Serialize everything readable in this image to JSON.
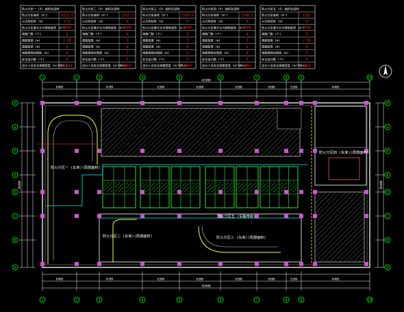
{
  "title_blocks": [
    {
      "rows": [
        {
          "label": "防火分区一 (4) 面积及说明",
          "value": ""
        },
        {
          "label": "防火分区面积 (m²)",
          "value": "2253.8"
        },
        {
          "label": "火灾危险性 (m)",
          "value": "3.6"
        },
        {
          "label": "防火分区最大允许建筑面积 (m²)",
          "value": "4000"
        },
        {
          "label": "疏散门数 (个)",
          "value": "4"
        },
        {
          "label": "疏散宽度 (m)",
          "value": "1.88"
        },
        {
          "label": "疏散距离 (m)",
          "value": "5"
        },
        {
          "label": "疏散楼梯间宽度 (m)",
          "value": "8"
        },
        {
          "label": "安全出口数 (个)",
          "value": "6"
        },
        {
          "label": "设计人员安全疏散宽度 (m/100人)",
          "value": "7.100"
        }
      ]
    },
    {
      "rows": [
        {
          "label": "防火分区二 (4) 面积及说明",
          "value": ""
        },
        {
          "label": "防火分区面积 (m²)",
          "value": "1232.3"
        },
        {
          "label": "火灾危险性 (m)",
          "value": "4"
        },
        {
          "label": "防火分区最大允许建筑面积 (m²)",
          "value": "4000"
        },
        {
          "label": "疏散门数 (个)",
          "value": "4"
        },
        {
          "label": "疏散宽度 (m)",
          "value": "3"
        },
        {
          "label": "疏散距离 (m)",
          "value": "4"
        },
        {
          "label": "疏散楼梯间宽度 (m)",
          "value": "7"
        },
        {
          "label": "安全出口数 (个)",
          "value": "5"
        },
        {
          "label": "设计人员安全疏散宽度 (m/100人)",
          "value": "4000"
        }
      ]
    },
    {
      "rows": [
        {
          "label": "防火分区三 (4) 面积及说明",
          "value": ""
        },
        {
          "label": "防火分区面积 (m²)",
          "value": "1914.0"
        },
        {
          "label": "火灾危险性 (m)",
          "value": "4"
        },
        {
          "label": "防火分区最大允许建筑面积 (m²)",
          "value": "4000"
        },
        {
          "label": "疏散门数 (个)",
          "value": "5"
        },
        {
          "label": "疏散宽度 (m)",
          "value": "3"
        },
        {
          "label": "疏散距离 (m)",
          "value": "6"
        },
        {
          "label": "疏散楼梯间宽度 (m)",
          "value": "5"
        },
        {
          "label": "安全出口数 (个)",
          "value": "5"
        },
        {
          "label": "设计人员安全疏散宽度 (m/100人)",
          "value": "4000"
        }
      ]
    },
    {
      "rows": [
        {
          "label": "防火分区四 (4) 面积及说明",
          "value": ""
        },
        {
          "label": "防火分区面积 (m²)",
          "value": "1548.1"
        },
        {
          "label": "火灾危险性 (m)",
          "value": "4"
        },
        {
          "label": "防火分区最大允许建筑面积 (m²)",
          "value": "4000"
        },
        {
          "label": "疏散门数 (个)",
          "value": "4"
        },
        {
          "label": "疏散宽度 (m)",
          "value": "3"
        },
        {
          "label": "疏散距离 (m)",
          "value": "5"
        },
        {
          "label": "疏散楼梯间宽度 (m)",
          "value": "4"
        },
        {
          "label": "安全出口数 (个)",
          "value": "5"
        },
        {
          "label": "设计人员安全疏散宽度 (m/100人)",
          "value": "4000"
        }
      ]
    },
    {
      "rows": [
        {
          "label": "防火分区五 (4) 面积及说明",
          "value": ""
        },
        {
          "label": "防火分区面积 (m²)",
          "value": "1182"
        },
        {
          "label": "火灾危险性 (m)",
          "value": "4"
        },
        {
          "label": "防火分区最大允许建筑面积 (m²)",
          "value": "4000"
        },
        {
          "label": "疏散门数 (个)",
          "value": "4"
        },
        {
          "label": "疏散宽度 (m)",
          "value": "2.96"
        },
        {
          "label": "疏散距离 (m)",
          "value": "6"
        },
        {
          "label": "疏散楼梯间宽度 (m)",
          "value": "5"
        },
        {
          "label": "安全出口数 (个)",
          "value": "4"
        },
        {
          "label": "设计人员安全疏散宽度 (m/100人)",
          "value": "4000"
        }
      ]
    }
  ],
  "overall_dims": {
    "top": "42900",
    "bottom": "42900",
    "left": "20400",
    "right": "20400"
  },
  "top_dims": [
    "8400",
    "8700",
    "6300",
    "6300",
    "6300",
    "6300",
    "5100",
    "8400"
  ],
  "bottom_dims": [
    "8400",
    "8700",
    "6300",
    "6300",
    "6300",
    "6300",
    "5100",
    "8400"
  ],
  "column_axes_top": [
    "1",
    "2",
    "3",
    "4",
    "5",
    "6",
    "7",
    "8",
    "9",
    "10"
  ],
  "column_axes_bottom": [
    "1",
    "2",
    "3",
    "4",
    "5",
    "6",
    "7",
    "8",
    "9",
    "10"
  ],
  "row_axes_left": [
    "H",
    "G",
    "F",
    "E",
    "D",
    "C",
    "B",
    "A"
  ],
  "row_axes_right": [
    "H",
    "G",
    "F",
    "E",
    "D",
    "C",
    "B",
    "A"
  ],
  "zone_labels": [
    {
      "text": "防火分区一 (车库)(局部面积)"
    },
    {
      "text": "防火分区二 (车库)(局部面积)"
    },
    {
      "text": "防火分区三 (车库)(局部面积)"
    },
    {
      "text": "防火分区四 (车库)(局部面积)"
    },
    {
      "text": "防火分区五 (设备用房)"
    }
  ],
  "north_arrow": "north-arrow-icon",
  "colors": {
    "background": "#000000",
    "axis": "#00ff00",
    "wall": "#c0c0c0",
    "column": "#ff66ff",
    "dimension": "#ffffff",
    "hatch": "#9a9a9a",
    "value_red": "#ff2020",
    "zone_yellow": "#ffff00",
    "ramp": "#00ffff"
  }
}
